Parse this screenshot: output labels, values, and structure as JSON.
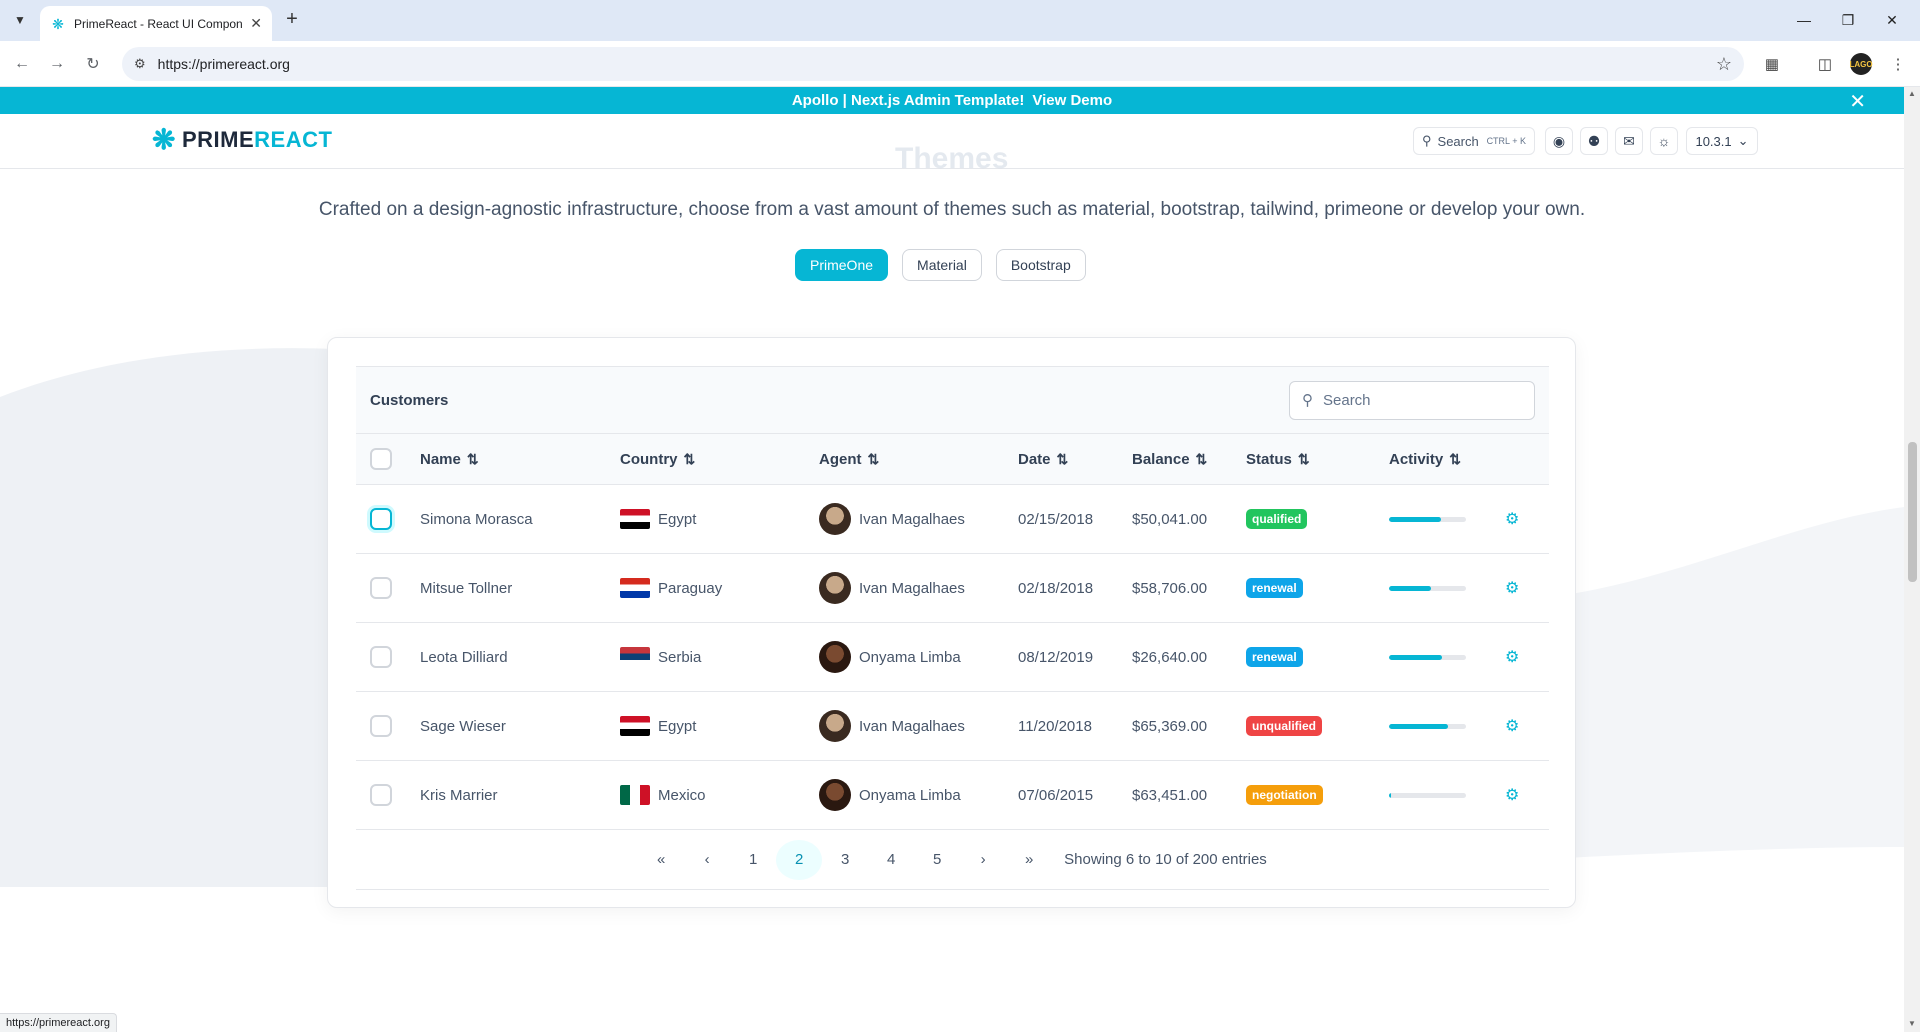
{
  "browser": {
    "tab_title": "PrimeReact - React UI Compone",
    "url": "https://primereact.org",
    "status_url": "https://primereact.org",
    "profile_initials": "LAGO"
  },
  "banner": {
    "text": "Apollo | Next.js Admin Template!",
    "link": "View Demo"
  },
  "topbar": {
    "logo_part1": "PRIME",
    "logo_part2": "REACT",
    "ghost_title": "Themes",
    "search_label": "Search",
    "search_shortcut": "CTRL + K",
    "version": "10.3.1"
  },
  "tagline": "Crafted on a design-agnostic infrastructure, choose from a vast amount of themes such as material, bootstrap, tailwind, primeone or develop your own.",
  "themes": [
    "PrimeOne",
    "Material",
    "Bootstrap"
  ],
  "table": {
    "title": "Customers",
    "search_placeholder": "Search",
    "columns": [
      "Name",
      "Country",
      "Agent",
      "Date",
      "Balance",
      "Status",
      "Activity"
    ],
    "rows": [
      {
        "name": "Simona Morasca",
        "country": "Egypt",
        "agent": "Ivan Magalhaes",
        "date": "02/15/2018",
        "balance": "$50,041.00",
        "status": "qualified",
        "activity": 0.67
      },
      {
        "name": "Mitsue Tollner",
        "country": "Paraguay",
        "agent": "Ivan Magalhaes",
        "date": "02/18/2018",
        "balance": "$58,706.00",
        "status": "renewal",
        "activity": 0.55
      },
      {
        "name": "Leota Dilliard",
        "country": "Serbia",
        "agent": "Onyama Limba",
        "date": "08/12/2019",
        "balance": "$26,640.00",
        "status": "renewal",
        "activity": 0.69
      },
      {
        "name": "Sage Wieser",
        "country": "Egypt",
        "agent": "Ivan Magalhaes",
        "date": "11/20/2018",
        "balance": "$65,369.00",
        "status": "unqualified",
        "activity": 0.76
      },
      {
        "name": "Kris Marrier",
        "country": "Mexico",
        "agent": "Onyama Limba",
        "date": "07/06/2015",
        "balance": "$63,451.00",
        "status": "negotiation",
        "activity": 0.03
      }
    ],
    "status_colors": {
      "qualified": "#22c55e",
      "renewal": "#0ea5e9",
      "unqualified": "#ef4444",
      "negotiation": "#f59e0b"
    },
    "paginator": {
      "pages": [
        "1",
        "2",
        "3",
        "4",
        "5"
      ],
      "current": "2",
      "report": "Showing 6 to 10 of 200 entries"
    }
  },
  "colors": {
    "accent": "#06b6d4"
  }
}
